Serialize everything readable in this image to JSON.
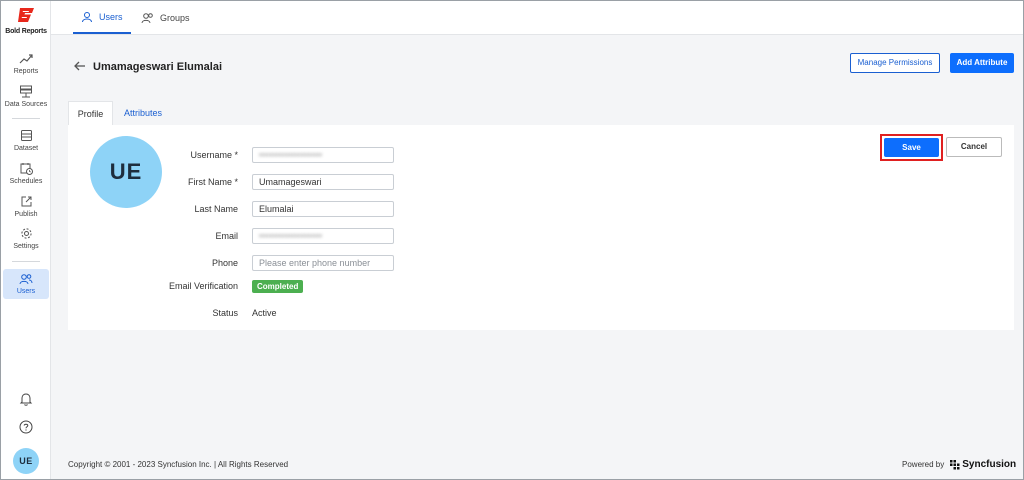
{
  "app": {
    "logo_text": "Bold Reports",
    "logo_color": "#e8281c"
  },
  "sidebar": {
    "items": [
      {
        "label": "Reports",
        "icon": "trend-line-icon"
      },
      {
        "label": "Data Sources",
        "icon": "database-icon"
      },
      {
        "label": "Dataset",
        "icon": "dataset-icon"
      },
      {
        "label": "Schedules",
        "icon": "calendar-clock-icon"
      },
      {
        "label": "Publish",
        "icon": "publish-icon"
      },
      {
        "label": "Settings",
        "icon": "gear-icon"
      },
      {
        "label": "Users",
        "icon": "users-icon",
        "active": true
      }
    ],
    "bottom": {
      "notifications_icon": "bell-icon",
      "help_icon": "help-icon",
      "avatar_initials": "UE"
    }
  },
  "top_tabs": [
    {
      "label": "Users",
      "active": true
    },
    {
      "label": "Groups",
      "active": false
    }
  ],
  "header": {
    "title": "Umamageswari Elumalai",
    "manage_permissions": "Manage Permissions",
    "add_attribute": "Add Attribute"
  },
  "tabs": [
    {
      "label": "Profile",
      "active": true
    },
    {
      "label": "Attributes",
      "active": false
    }
  ],
  "profile": {
    "avatar_initials": "UE",
    "avatar_color": "#8ed3f7",
    "fields": {
      "username": {
        "label": "Username *",
        "value": "••••••••••••••••••••"
      },
      "first_name": {
        "label": "First Name *",
        "value": "Umamageswari"
      },
      "last_name": {
        "label": "Last Name",
        "value": "Elumalai"
      },
      "email": {
        "label": "Email",
        "value": "••••••••••••••••••••"
      },
      "phone": {
        "label": "Phone",
        "placeholder": "Please enter phone number"
      }
    },
    "email_verification": {
      "label": "Email Verification",
      "value": "Completed"
    },
    "status": {
      "label": "Status",
      "value": "Active"
    },
    "save": "Save",
    "cancel": "Cancel"
  },
  "footer": {
    "copyright": "Copyright © 2001 - 2023 Syncfusion Inc.  |  All Rights Reserved",
    "powered_by": "Powered by",
    "brand": "Syncfusion"
  }
}
